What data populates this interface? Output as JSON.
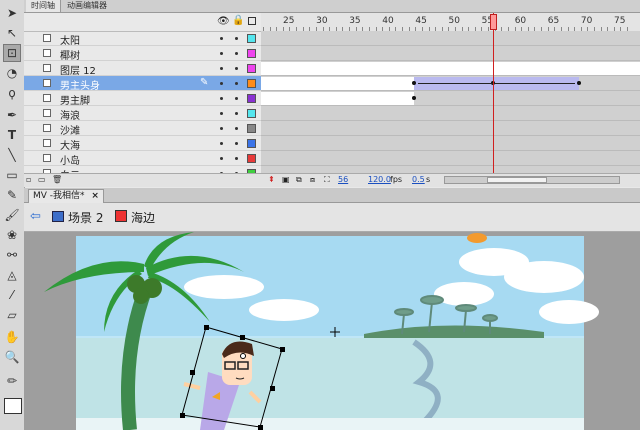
{
  "timeline_tabs": [
    "时间轴",
    "动画编辑器"
  ],
  "ruler_labels": [
    "25",
    "30",
    "35",
    "40",
    "45",
    "50",
    "55",
    "60",
    "65",
    "70",
    "75"
  ],
  "layers": [
    {
      "name": "太阳",
      "color": "#55e6ee",
      "selected": false
    },
    {
      "name": "椰树",
      "color": "#ee44ee",
      "selected": false
    },
    {
      "name": "图层 12",
      "color": "#ee44ee",
      "selected": false
    },
    {
      "name": "男主头身",
      "color": "#ff8c1a",
      "selected": true
    },
    {
      "name": "男主脚",
      "color": "#8a32d2",
      "selected": false
    },
    {
      "name": "海浪",
      "color": "#55e6ee",
      "selected": false
    },
    {
      "name": "沙滩",
      "color": "#888888",
      "selected": false
    },
    {
      "name": "大海",
      "color": "#3b74e8",
      "selected": false
    },
    {
      "name": "小岛",
      "color": "#e83a3a",
      "selected": false
    },
    {
      "name": "白云",
      "color": "#3fcf3f",
      "selected": false
    }
  ],
  "status": {
    "frame": "56",
    "fps": "120.0",
    "fps_unit": "fps",
    "time": "0.5",
    "time_unit": "s"
  },
  "document": {
    "tab_title": "MV -我相信*",
    "close": "×"
  },
  "scene": {
    "label": "场景 2",
    "symbol": "海边"
  },
  "current_frame": 56
}
